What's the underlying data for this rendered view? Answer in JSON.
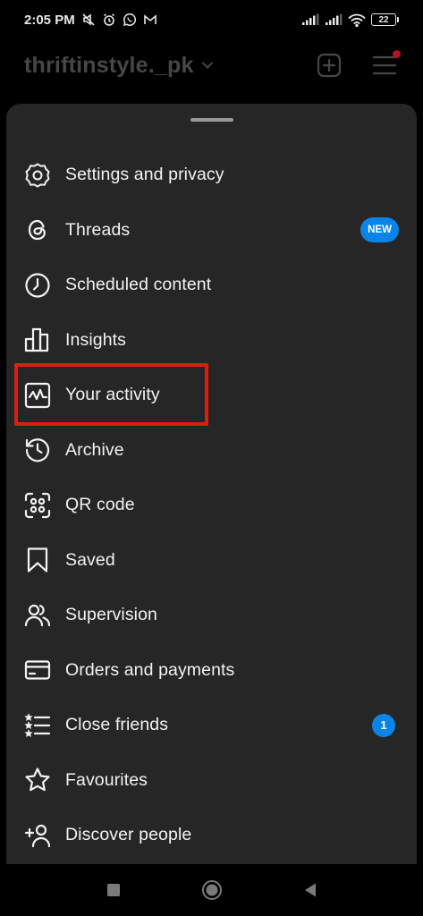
{
  "status_bar": {
    "time": "2:05 PM",
    "battery": "22",
    "icons": [
      "mute-icon",
      "alarm-icon",
      "whatsapp-icon",
      "gmail-icon",
      "signal-icon",
      "signal-icon",
      "wifi-icon",
      "battery-icon"
    ]
  },
  "header": {
    "username": "thriftinstyle._pk",
    "icons": [
      "chevron-down-icon",
      "new-post-icon",
      "menu-icon"
    ],
    "notification_dot_color": "#b3151f"
  },
  "menu": {
    "items": [
      {
        "label": "Settings and privacy",
        "icon": "settings-icon"
      },
      {
        "label": "Threads",
        "icon": "threads-icon",
        "badge": "NEW"
      },
      {
        "label": "Scheduled content",
        "icon": "clock-icon"
      },
      {
        "label": "Insights",
        "icon": "insights-icon"
      },
      {
        "label": "Your activity",
        "icon": "activity-icon"
      },
      {
        "label": "Archive",
        "icon": "archive-icon"
      },
      {
        "label": "QR code",
        "icon": "qr-code-icon"
      },
      {
        "label": "Saved",
        "icon": "bookmark-icon"
      },
      {
        "label": "Supervision",
        "icon": "supervision-icon"
      },
      {
        "label": "Orders and payments",
        "icon": "card-icon"
      },
      {
        "label": "Close friends",
        "icon": "close-friends-icon",
        "badge": "1"
      },
      {
        "label": "Favourites",
        "icon": "star-icon"
      },
      {
        "label": "Discover people",
        "icon": "add-person-icon"
      }
    ]
  },
  "colors": {
    "sheet_background": "#262626",
    "accent_blue": "#0b84e8",
    "highlight_red": "#e01e10"
  },
  "nav_bar": {
    "icons": [
      "recents-icon",
      "home-icon",
      "back-icon"
    ]
  }
}
